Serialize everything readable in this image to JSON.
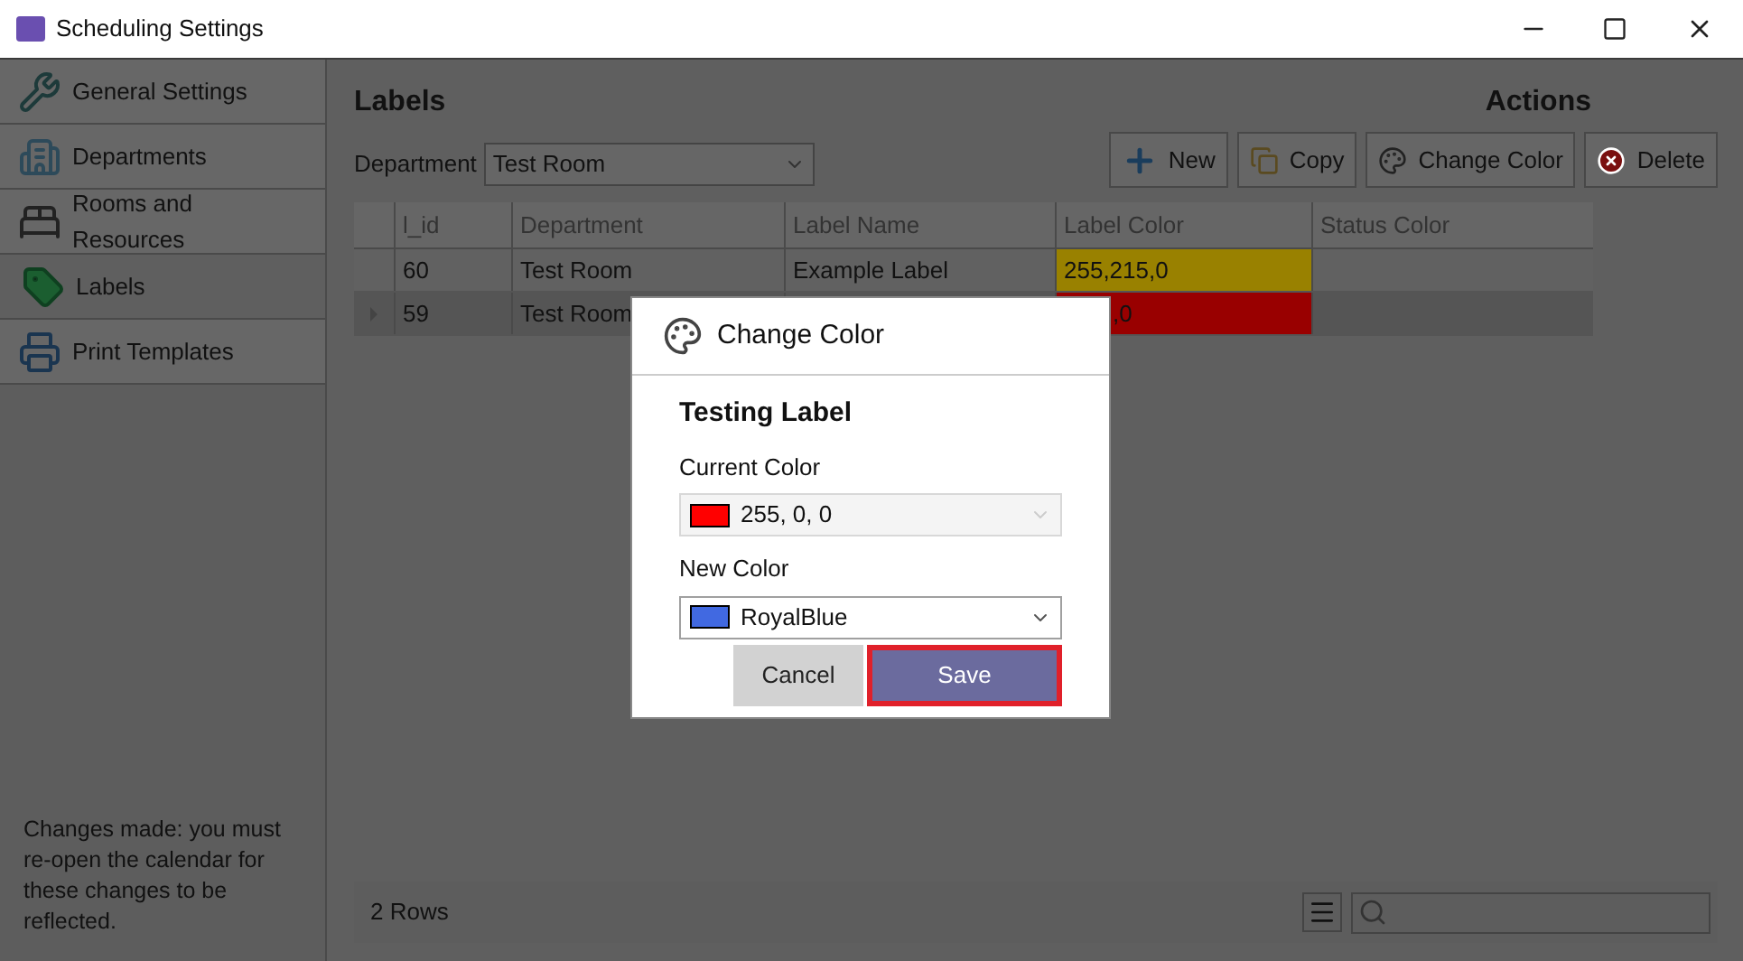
{
  "window": {
    "title": "Scheduling Settings"
  },
  "sidebar": {
    "items": [
      {
        "label": "General Settings",
        "kind": "tools",
        "selected": false
      },
      {
        "label": "Departments",
        "kind": "building",
        "selected": false
      },
      {
        "label": "Rooms and Resources",
        "kind": "bed",
        "selected": false
      },
      {
        "label": "Labels",
        "kind": "tag",
        "selected": true
      },
      {
        "label": "Print Templates",
        "kind": "printer",
        "selected": false
      }
    ],
    "note": "Changes made: you must re-open the calendar for these changes to be reflected."
  },
  "main": {
    "title": "Labels",
    "actions_title": "Actions",
    "department": {
      "label": "Department",
      "value": "Test Room"
    },
    "actions": [
      {
        "label": "New",
        "kind": "new"
      },
      {
        "label": "Copy",
        "kind": "copy"
      },
      {
        "label": "Change Color",
        "kind": "palette"
      },
      {
        "label": "Delete",
        "kind": "delete"
      }
    ],
    "table": {
      "columns": [
        "l_id",
        "Department",
        "Label Name",
        "Label Color",
        "Status Color"
      ],
      "rows": [
        {
          "selected": false,
          "cells": [
            "60",
            "Test Room",
            "Example Label",
            "255,215,0",
            ""
          ],
          "color": "#998100"
        },
        {
          "selected": true,
          "cells": [
            "59",
            "Test Room",
            "",
            ",0",
            ""
          ],
          "color": "#990000"
        }
      ]
    },
    "row_count": "2 Rows"
  },
  "dialog": {
    "title": "Change Color",
    "heading": "Testing Label",
    "current": {
      "label": "Current Color",
      "value": "255, 0, 0",
      "color": "#ff0000",
      "disabled": true
    },
    "new": {
      "label": "New Color",
      "value": "RoyalBlue",
      "color": "#4169e1",
      "disabled": false
    },
    "buttons": [
      {
        "label": "Cancel",
        "kind": "secondary"
      },
      {
        "label": "Save",
        "kind": "primary",
        "focused": true
      }
    ]
  }
}
